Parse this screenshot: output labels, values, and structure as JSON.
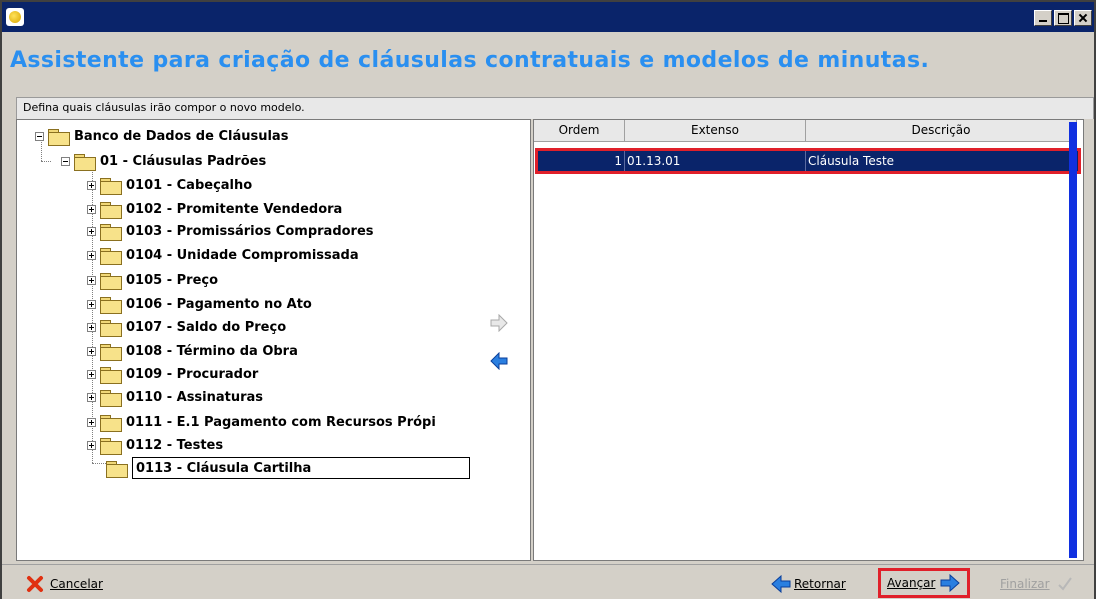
{
  "window": {
    "title": "",
    "controls": [
      "minimize",
      "maximize",
      "close"
    ]
  },
  "header": {
    "title": "Assistente para criação de cláusulas contratuais e modelos de minutas."
  },
  "instruction": "Defina quais cláusulas irão compor o novo modelo.",
  "tree": {
    "root": "Banco de Dados de Cláusulas",
    "group": "01 - Cláusulas Padrões",
    "items": [
      "0101 - Cabeçalho",
      "0102 - Promitente Vendedora",
      "0103 - Promissários Compradores",
      "0104 - Unidade Compromissada",
      "0105 - Preço",
      "0106 - Pagamento no Ato",
      "0107 - Saldo do Preço",
      "0108 - Término da Obra",
      "0109 - Procurador",
      "0110 - Assinaturas",
      "0111 - E.1 Pagamento com Recursos Própi",
      "0112 - Testes"
    ],
    "selected": "0113 - Cláusula Cartilha"
  },
  "transfer": {
    "add_icon": "arrow-right-icon",
    "remove_icon": "arrow-left-icon"
  },
  "grid": {
    "columns": [
      "Ordem",
      "Extenso",
      "Descrição"
    ],
    "rows": [
      {
        "ordem": "1",
        "extenso": "01.13.01",
        "descricao": "Cláusula Teste"
      }
    ]
  },
  "footer": {
    "cancel_label": "Cancelar",
    "back_label": "Retornar",
    "next_label": "Avançar",
    "finish_label": "Finalizar"
  },
  "colors": {
    "title_bar": "#0a246a",
    "header_text": "#2a8ff0",
    "selection": "#0a246a",
    "highlight_border": "#e0202a",
    "scrollbar": "#1030e0"
  }
}
